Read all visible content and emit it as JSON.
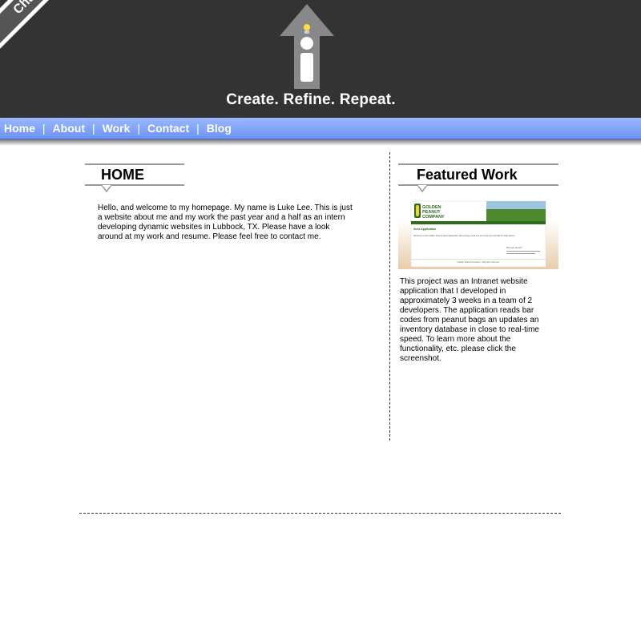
{
  "header": {
    "banner_name": "Charles (Luke) Lee",
    "tagline": "Create. Refine. Repeat."
  },
  "nav": {
    "items": [
      {
        "label": "Home"
      },
      {
        "label": "About"
      },
      {
        "label": "Work"
      },
      {
        "label": "Contact"
      },
      {
        "label": "Blog"
      }
    ],
    "separator": "|"
  },
  "home": {
    "heading": "HOME",
    "body": "Hello, and welcome to my homepage.  My name is Luke Lee.   This is just a website about me and my work the past year and a half as an intern developing dynamic websites in Lubbock, TX.  Please have a look around at my work and resume.  Please feel free to contact me."
  },
  "featured": {
    "heading": "Featured Work",
    "screenshot": {
      "company_name": "GOLDEN PEANUT COMPANY",
      "title": "Seed Application",
      "welcome": "Welcome to the Golden Peanut Seed Application Home Page. Feel free to browse around with the links above.",
      "sidebar_title": "Did you know?",
      "footer": "Golden Peanut Company · All rights reserved."
    },
    "description": "This project was an Intranet website application that I developed in approximately 3 weeks in a team of 2 developers.  The application reads bar codes from peanut bags an updates an inventory database in close to real-time speed.  To learn more about the functionality, etc. please click the screenshot."
  },
  "colors": {
    "header_bg": "#333333",
    "nav_blue": "#7a9ef7",
    "logo_gray": "#888888",
    "bulb_yellow": "#ffdd44",
    "peanut_green": "#2e6b1e"
  }
}
